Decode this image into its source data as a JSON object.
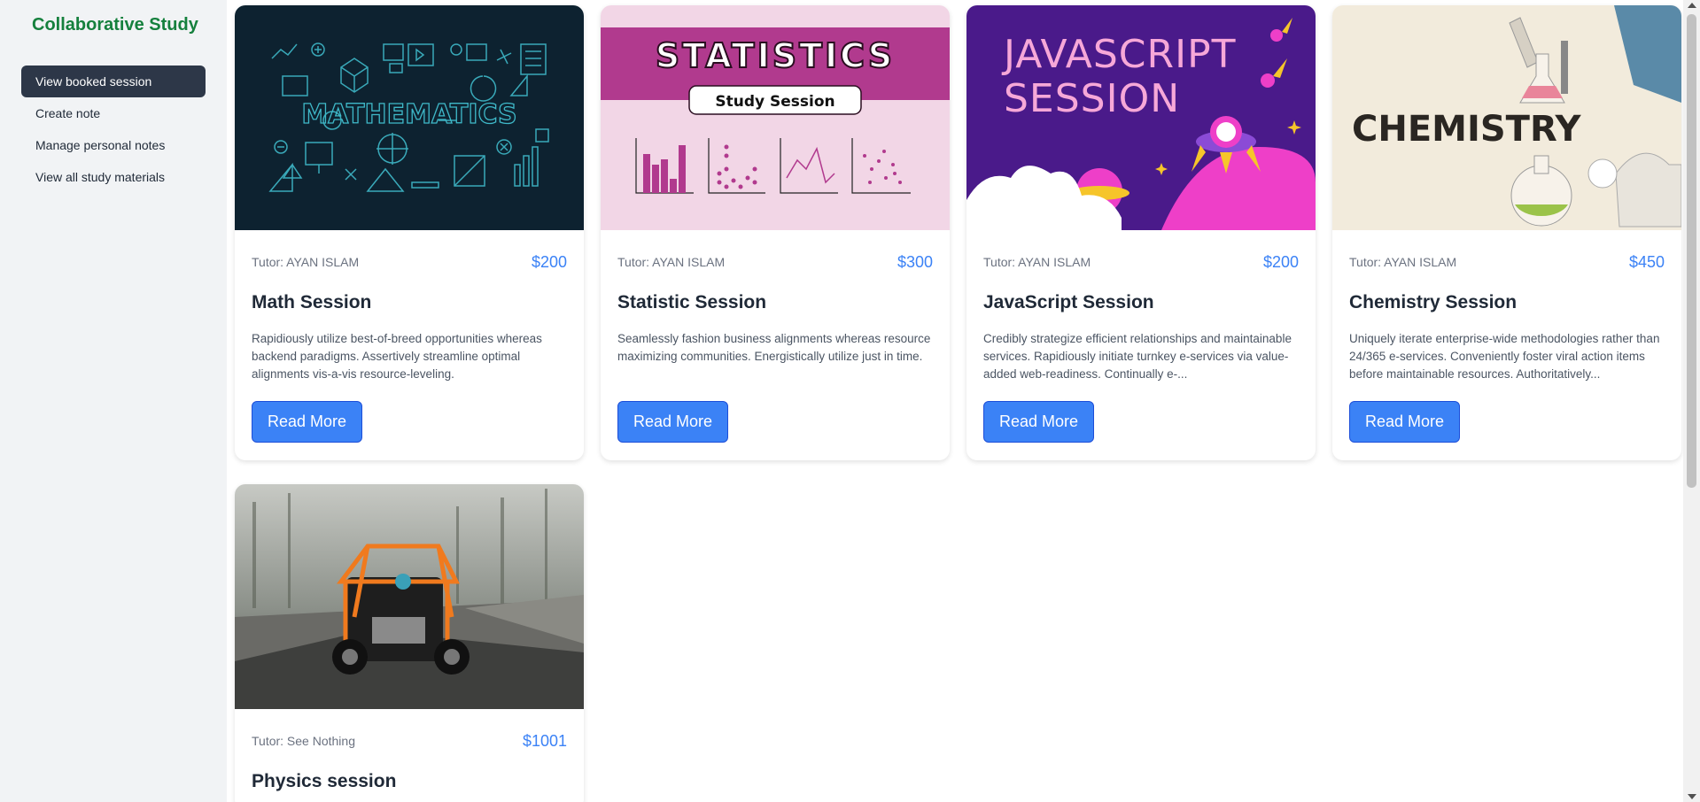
{
  "app": {
    "brand": "Collaborative Study"
  },
  "sidebar": {
    "items": [
      {
        "label": "View booked session",
        "active": true
      },
      {
        "label": "Create note"
      },
      {
        "label": "Manage personal notes"
      },
      {
        "label": "View all study materials"
      }
    ]
  },
  "cards": [
    {
      "image_text": "MATHEMATICS",
      "tutor": "Tutor: AYAN ISLAM",
      "price": "$200",
      "title": "Math Session",
      "description": "Rapidiously utilize best-of-breed opportunities whereas backend paradigms. Assertively streamline optimal alignments vis-a-vis resource-leveling.",
      "button": "Read More"
    },
    {
      "image_text": "STATISTICS",
      "image_subtext": "Study Session",
      "tutor": "Tutor: AYAN ISLAM",
      "price": "$300",
      "title": "Statistic Session",
      "description": "Seamlessly fashion business alignments whereas resource maximizing communities. Energistically utilize just in time.",
      "button": "Read More"
    },
    {
      "image_text": "JAVASCRIPT",
      "image_subtext": "SESSION",
      "tutor": "Tutor: AYAN ISLAM",
      "price": "$200",
      "title": "JavaScript Session",
      "description": "Credibly strategize efficient relationships and maintainable services. Rapidiously initiate turnkey e-services via value-added web-readiness. Continually e-...",
      "button": "Read More"
    },
    {
      "image_text": "CHEMISTRY",
      "tutor": "Tutor: AYAN ISLAM",
      "price": "$450",
      "title": "Chemistry Session",
      "description": "Uniquely iterate enterprise-wide methodologies rather than 24/365 e-services. Conveniently foster viral action items before maintainable resources. Authoritatively...",
      "button": "Read More"
    },
    {
      "tutor": "Tutor: See Nothing",
      "price": "$1001",
      "title": "Physics session"
    }
  ]
}
